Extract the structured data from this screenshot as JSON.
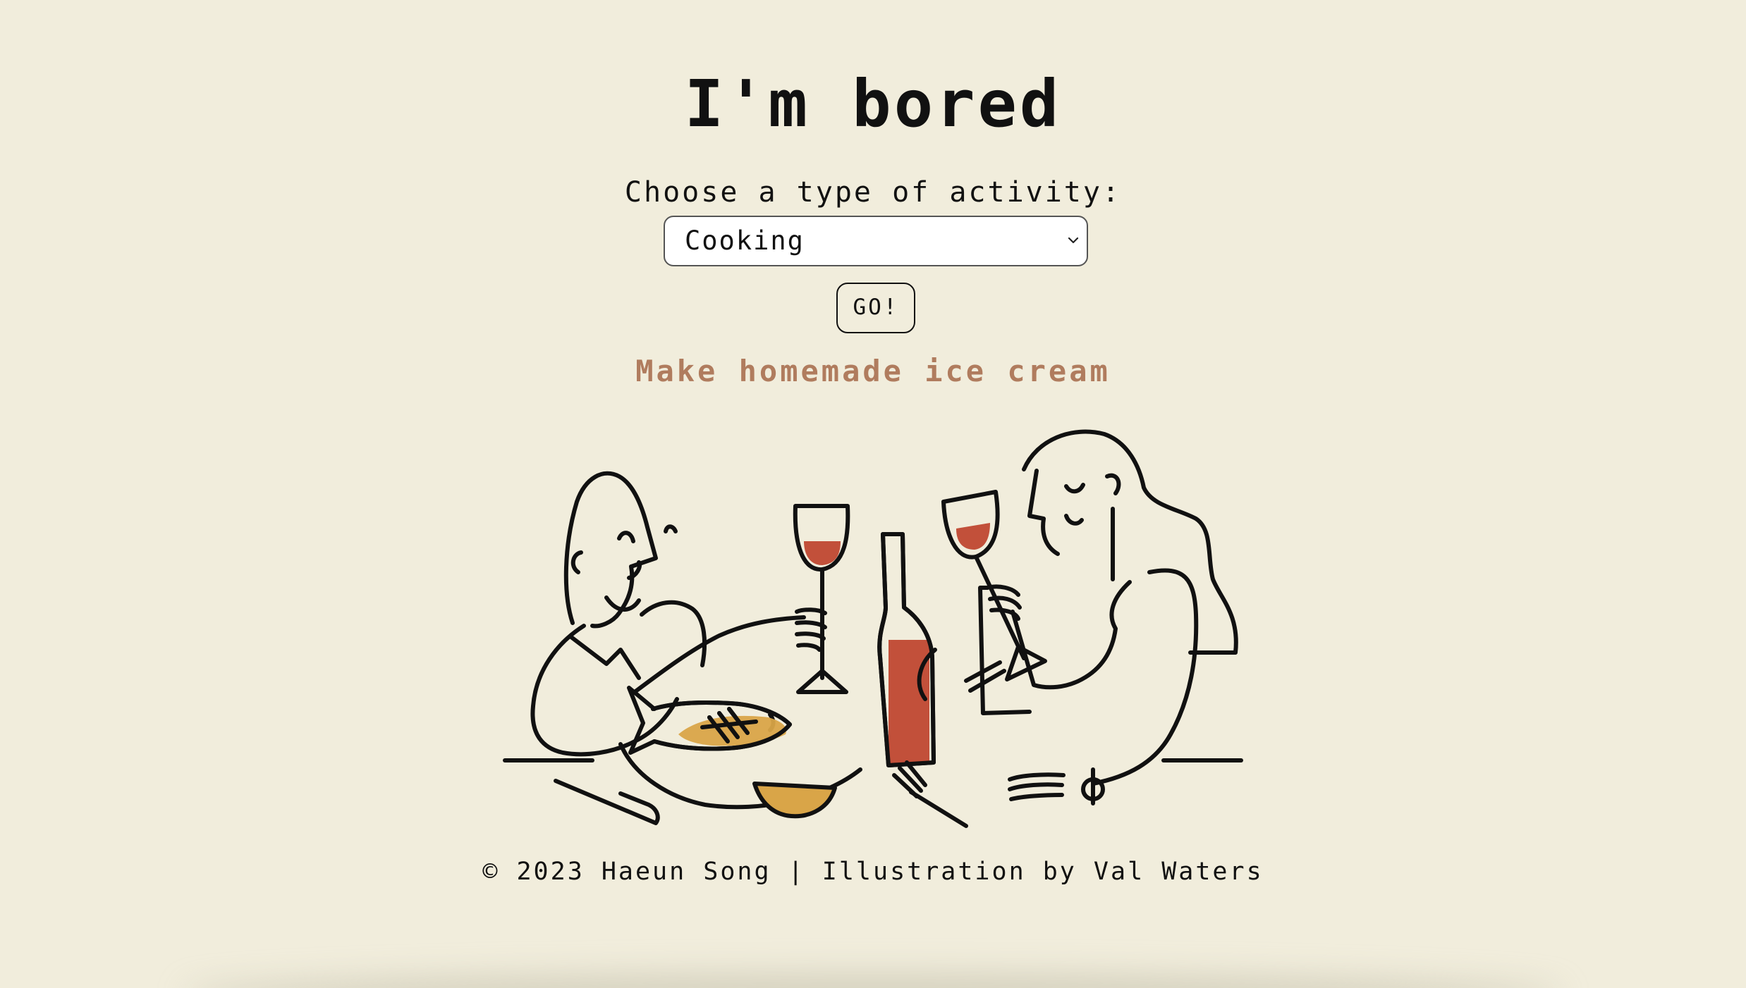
{
  "header": {
    "title": "I'm bored"
  },
  "form": {
    "label": "Choose a type of activity:",
    "selected_activity": "Cooking",
    "submit_label": "GO!"
  },
  "result": {
    "activity": "Make homemade ice cream"
  },
  "footer": {
    "text": "© 2023 Haeun Song | Illustration by Val Waters"
  },
  "colors": {
    "background": "#f1eddc",
    "result_text": "#b07c5e",
    "wine_red": "#c2503a",
    "fish_gold": "#d9a548"
  },
  "icons": {
    "select_arrow": "chevron-down-icon"
  }
}
